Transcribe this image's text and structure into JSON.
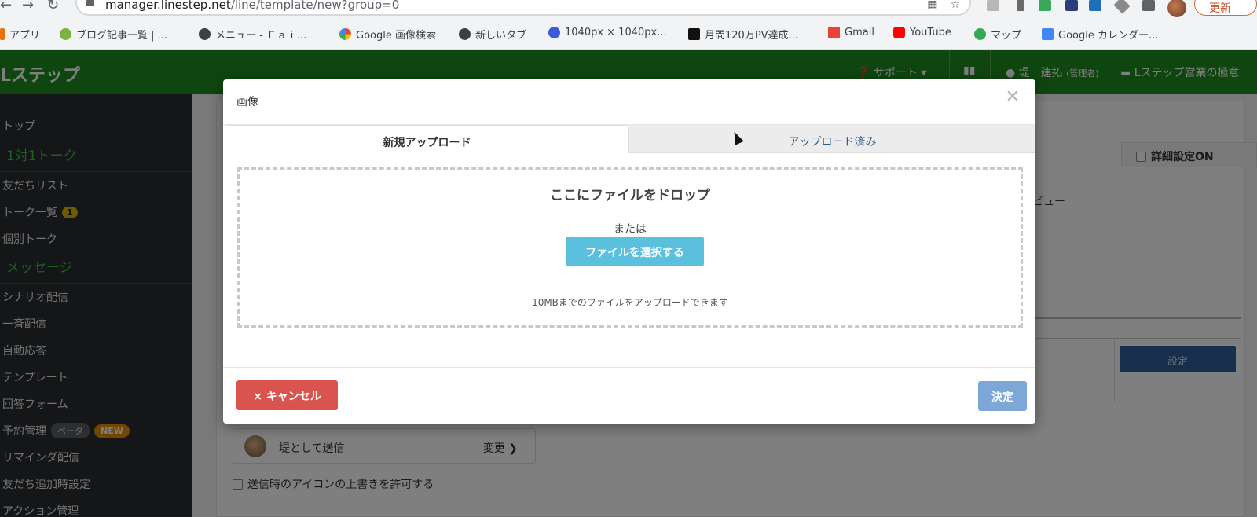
{
  "browser": {
    "url_host": "manager.linestep.net",
    "url_path": "/line/template/new?group=0",
    "update_label": "更新",
    "bookmarks": [
      {
        "label": "アプリ",
        "icon": "apps-grid-icon"
      },
      {
        "label": "ブログ記事一覧 | ...",
        "icon": "bookmark-site-icon"
      },
      {
        "label": "メニュー - Ｆａｉ...",
        "icon": "globe-icon"
      },
      {
        "label": "Google 画像検索",
        "icon": "google-icon"
      },
      {
        "label": "新しいタブ",
        "icon": "globe-icon"
      },
      {
        "label": "1040px × 1040px...",
        "icon": "site-icon"
      },
      {
        "label": "月間120万PV達成...",
        "icon": "w-icon"
      },
      {
        "label": "Gmail",
        "icon": "gmail-icon"
      },
      {
        "label": "YouTube",
        "icon": "youtube-icon"
      },
      {
        "label": "マップ",
        "icon": "maps-icon"
      },
      {
        "label": "Google カレンダー...",
        "icon": "calendar-icon"
      }
    ]
  },
  "app": {
    "logo": "Lステップ",
    "support": "サポート ▾",
    "user": "堤　建拓",
    "role": "(管理者)",
    "account": "Lステップ営業の極意",
    "accent": "#1e8d1e"
  },
  "sidebar": {
    "items": [
      {
        "label": "トップ"
      },
      {
        "label": "1対1トーク",
        "type": "head"
      },
      {
        "label": "友だちリスト"
      },
      {
        "label": "トーク一覧",
        "badge": "1"
      },
      {
        "label": "個別トーク"
      },
      {
        "label": "メッセージ",
        "type": "head"
      },
      {
        "label": "シナリオ配信"
      },
      {
        "label": "一斉配信"
      },
      {
        "label": "自動応答"
      },
      {
        "label": "テンプレート"
      },
      {
        "label": "回答フォーム"
      },
      {
        "label": "予約管理",
        "badge_beta": "ベータ",
        "badge_new": "NEW"
      },
      {
        "label": "リマインダ配信"
      },
      {
        "label": "友だち追加時設定"
      },
      {
        "label": "アクション管理"
      }
    ]
  },
  "page": {
    "detail_setting": "詳細設定ON",
    "preview": "ビュー",
    "set_button": "設定",
    "sender_name": "堤として送信",
    "sender_change": "変更",
    "allow_icon_override": "送信時のアイコンの上書きを許可する"
  },
  "modal": {
    "title": "画像",
    "tabs": [
      "新規アップロード",
      "アップロード済み"
    ],
    "drop_title": "ここにファイルをドロップ",
    "drop_or": "または",
    "select_button": "ファイルを選択する",
    "note": "10MBまでのファイルをアップロードできます",
    "cancel": "キャンセル",
    "ok": "決定"
  }
}
